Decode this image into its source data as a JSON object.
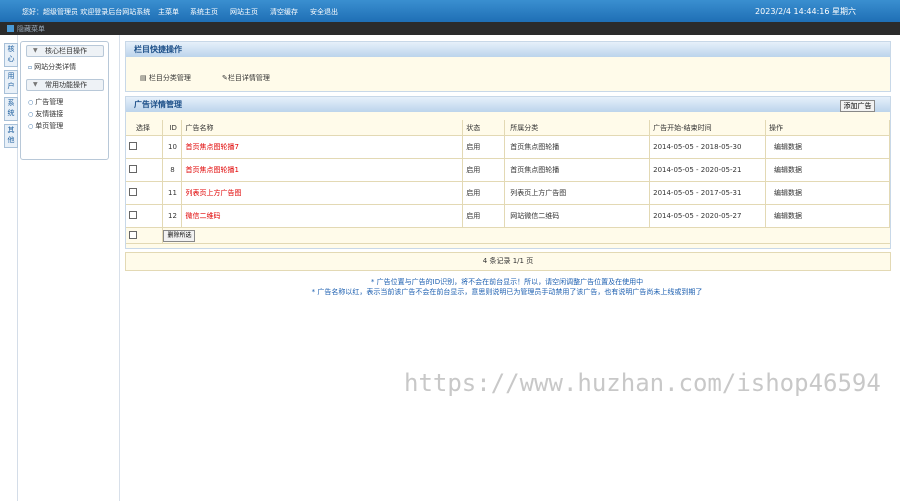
{
  "topbar": {
    "greeting": "您好：超级管理员 欢迎登录后台网站系统",
    "nav": [
      "主菜单",
      "系统主页",
      "网站主页",
      "清空缓存",
      "安全退出"
    ],
    "clock": "2023/2/4 14:44:16 星期六"
  },
  "subbar": {
    "text": "隐藏菜单"
  },
  "sidebar": {
    "tabs": [
      "核心",
      "用户",
      "系统",
      "其他"
    ],
    "groups": [
      {
        "title": "核心栏目操作",
        "items": [
          "网站分类详情"
        ]
      },
      {
        "title": "常用功能操作",
        "items": [
          "广告管理",
          "友情链接",
          "单页管理"
        ]
      }
    ]
  },
  "quick": {
    "title": "栏目快捷操作",
    "links": [
      "栏目分类管理",
      "栏目详情管理"
    ]
  },
  "ads": {
    "title": "广告详情管理",
    "add_label": "添加广告",
    "columns": [
      "选择",
      "ID",
      "广告名称",
      "状态",
      "所属分类",
      "广告开始-结束时间",
      "操作"
    ],
    "rows": [
      {
        "id": "10",
        "name": "首页焦点图轮播7",
        "status": "启用",
        "category": "首页焦点图轮播",
        "time": "2014-05-05 - 2018-05-30",
        "action": "编辑数据"
      },
      {
        "id": "8",
        "name": "首页焦点图轮播1",
        "status": "启用",
        "category": "首页焦点图轮播",
        "time": "2014-05-05 - 2020-05-21",
        "action": "编辑数据"
      },
      {
        "id": "11",
        "name": "列表页上方广告图",
        "status": "启用",
        "category": "列表页上方广告图",
        "time": "2014-05-05 - 2017-05-31",
        "action": "编辑数据"
      },
      {
        "id": "12",
        "name": "微信二维码",
        "status": "启用",
        "category": "网站微信二维码",
        "time": "2014-05-05 - 2020-05-27",
        "action": "编辑数据"
      }
    ],
    "delete_label": "删除所选"
  },
  "pager": {
    "text": "4 条记录 1/1 页"
  },
  "notes": [
    "* 广告位置与广告的ID识别，将不会在前台显示！所以，请空闲调整广告位置及在使用中",
    "* 广告名称以红，表示当前该广告不会在前台显示，意思则说明已为管理员手动禁用了该广告，也有说明广告尚未上线或到期了"
  ],
  "watermark": "https://www.huzhan.com/ishop46594",
  "colors": {
    "topbar": "#2a7cc2",
    "header_text": "#1c4f88",
    "disabled_ad": "#e00000",
    "panel_bg": "#fffbea"
  }
}
